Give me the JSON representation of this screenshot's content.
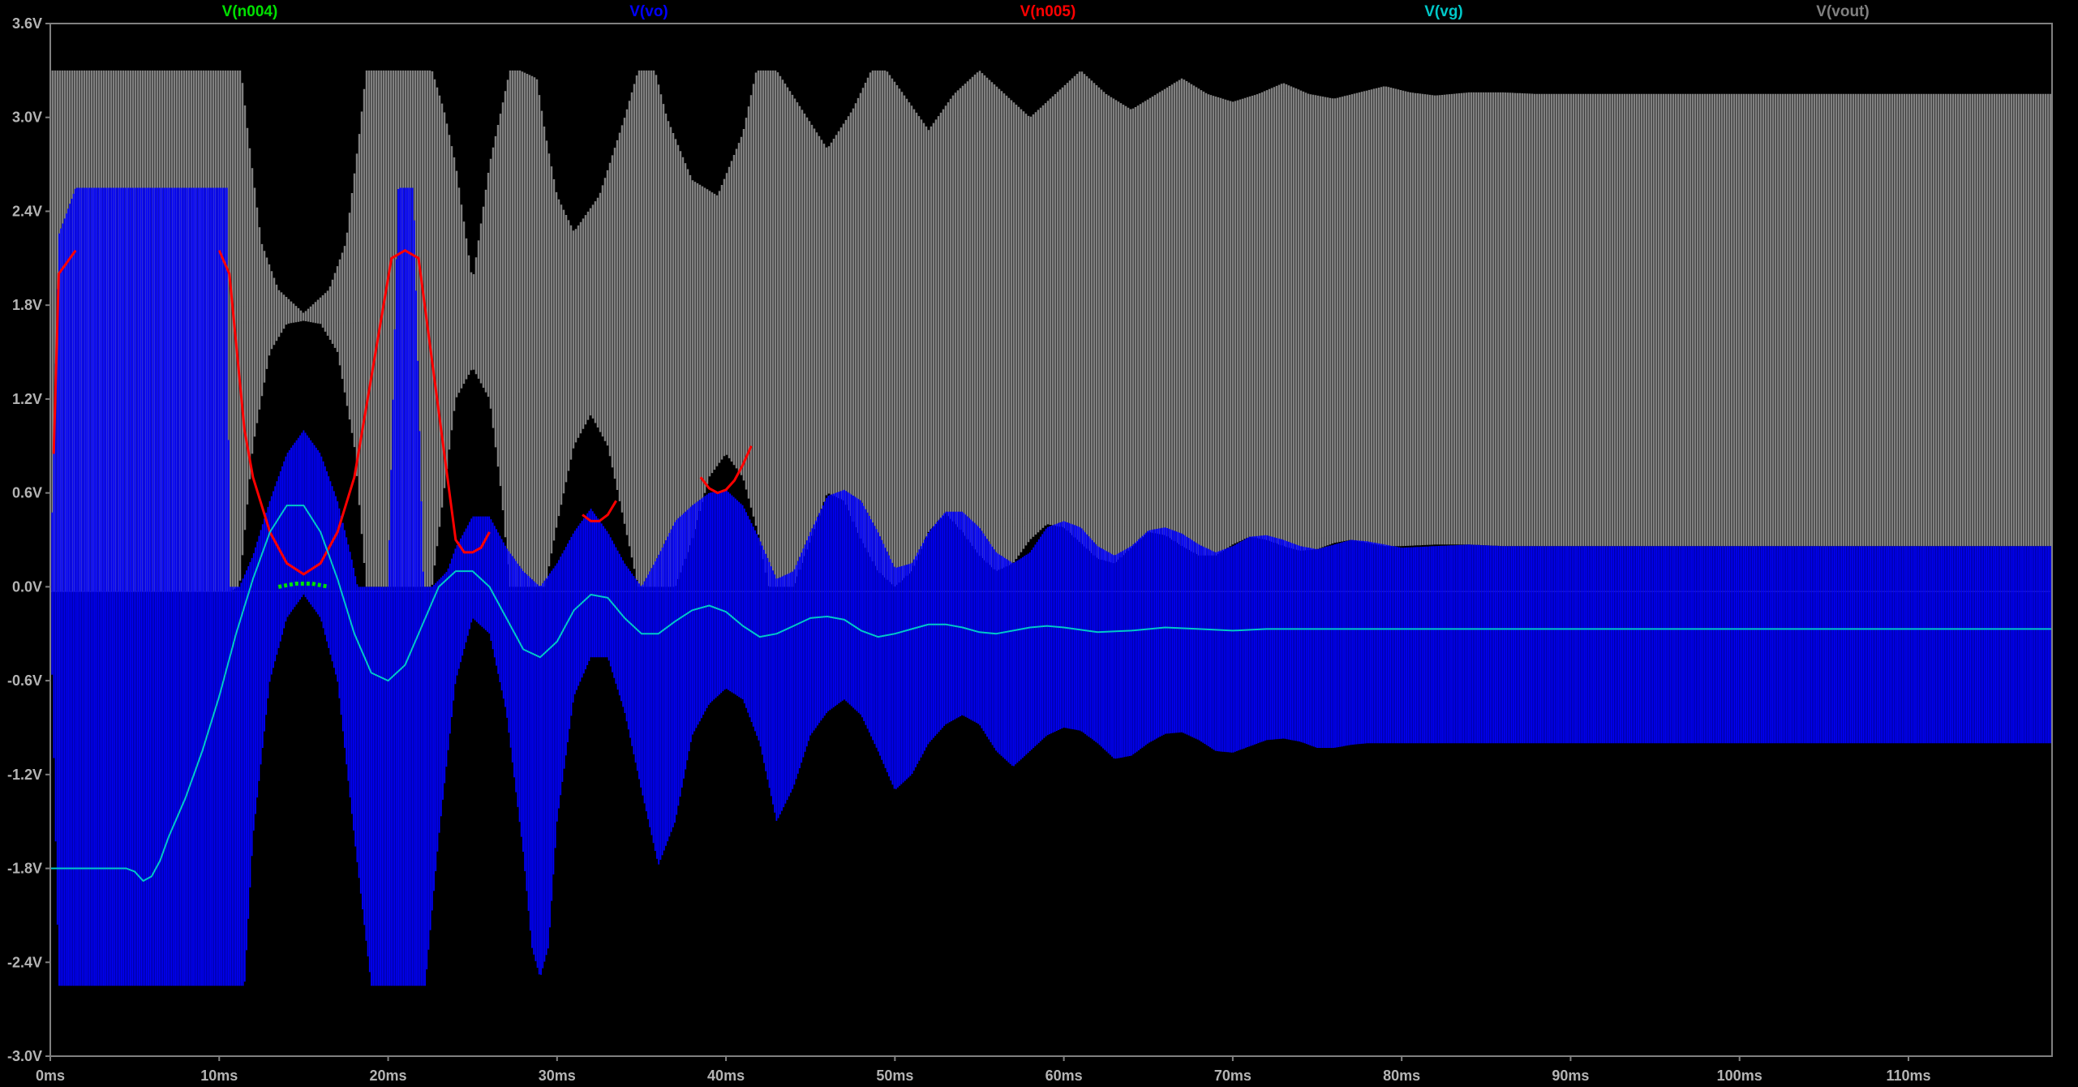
{
  "chart_data": {
    "type": "line",
    "title": "",
    "xlabel": "",
    "ylabel": "",
    "x_unit": "ms",
    "y_unit": "V",
    "xlim": [
      0,
      118.5
    ],
    "ylim": [
      -3.0,
      3.6
    ],
    "grid": false,
    "legend_placement": "top",
    "background": "#000000",
    "plot_border": "#808080",
    "x_ticks": [
      0,
      10,
      20,
      30,
      40,
      50,
      60,
      70,
      80,
      90,
      100,
      110
    ],
    "x_tick_labels": [
      "0ms",
      "10ms",
      "20ms",
      "30ms",
      "40ms",
      "50ms",
      "60ms",
      "70ms",
      "80ms",
      "90ms",
      "100ms",
      "110ms"
    ],
    "y_ticks": [
      3.6,
      3.0,
      2.4,
      1.8,
      1.2,
      0.6,
      0.0,
      -0.6,
      -1.2,
      -1.8,
      -2.4,
      -3.0
    ],
    "y_tick_labels": [
      "3.6V",
      "3.0V",
      "2.4V",
      "1.8V",
      "1.2V",
      "0.6V",
      "0.0V",
      "-0.6V",
      "-1.2V",
      "-1.8V",
      "-2.4V",
      "-3.0V"
    ],
    "series": [
      {
        "name": "V(n004)",
        "color": "#00e000",
        "description_note": "",
        "x": [
          13.5,
          14.0,
          14.5,
          15.0,
          15.5,
          16.0,
          16.5
        ],
        "y": [
          0.0,
          0.01,
          0.02,
          0.02,
          0.02,
          0.01,
          0.0
        ]
      },
      {
        "name": "V(vo)",
        "color": "#0000ff",
        "upper_envelope": {
          "x": [
            0,
            0.5,
            1.5,
            10.5,
            10.6,
            11.2,
            12,
            13,
            14,
            15,
            16,
            17,
            17.8,
            18.2,
            19.5,
            20,
            20.6,
            21.5,
            22.1,
            22.6,
            23.5,
            24,
            25,
            26,
            27,
            28,
            29,
            30,
            31,
            32,
            33,
            34,
            35,
            36,
            37,
            38,
            39,
            40,
            41,
            42,
            43,
            44,
            45,
            46,
            47,
            48,
            49,
            50,
            51,
            52,
            53,
            54,
            55,
            56,
            57,
            58,
            59,
            60,
            61,
            62,
            63,
            64,
            65,
            66,
            67,
            68,
            69,
            70,
            71,
            72,
            73,
            74,
            75,
            76,
            77,
            78,
            79,
            80,
            82,
            84,
            86,
            88,
            90,
            95,
            100,
            105,
            110,
            118.5
          ],
          "y": [
            0.0,
            2.25,
            2.55,
            2.55,
            0.0,
            0.0,
            0.2,
            0.55,
            0.85,
            1.0,
            0.85,
            0.55,
            0.2,
            0.0,
            0.0,
            0.0,
            2.55,
            2.55,
            0.0,
            0.0,
            0.1,
            0.25,
            0.45,
            0.45,
            0.25,
            0.1,
            0.0,
            0.15,
            0.35,
            0.5,
            0.35,
            0.15,
            0.0,
            0.2,
            0.42,
            0.52,
            0.6,
            0.62,
            0.52,
            0.3,
            0.05,
            0.1,
            0.35,
            0.58,
            0.62,
            0.55,
            0.35,
            0.12,
            0.15,
            0.35,
            0.48,
            0.48,
            0.38,
            0.22,
            0.15,
            0.22,
            0.38,
            0.42,
            0.38,
            0.26,
            0.2,
            0.26,
            0.36,
            0.38,
            0.34,
            0.27,
            0.22,
            0.26,
            0.32,
            0.33,
            0.3,
            0.26,
            0.24,
            0.27,
            0.3,
            0.29,
            0.27,
            0.25,
            0.26,
            0.27,
            0.26,
            0.26,
            0.26,
            0.26,
            0.26,
            0.26,
            0.26,
            0.26
          ]
        },
        "lower_envelope": {
          "x": [
            0,
            0.5,
            10.5,
            10.6,
            11.5,
            12,
            13,
            14,
            15,
            16,
            17,
            18,
            19,
            19.5,
            20,
            20.6,
            22.2,
            23,
            24,
            25,
            26,
            27,
            28,
            28.5,
            29,
            29.5,
            30,
            31,
            32,
            33,
            34,
            35,
            36,
            37,
            38,
            39,
            40,
            41,
            42,
            43,
            44,
            45,
            46,
            47,
            48,
            49,
            50,
            51,
            52,
            53,
            54,
            55,
            56,
            57,
            58,
            59,
            60,
            61,
            62,
            63,
            64,
            65,
            66,
            67,
            68,
            69,
            70,
            71,
            72,
            73,
            74,
            75,
            76,
            77,
            78,
            79,
            80,
            82,
            84,
            86,
            88,
            90,
            95,
            100,
            105,
            110,
            118.5
          ],
          "y": [
            -0.03,
            -2.55,
            -2.55,
            -2.55,
            -2.55,
            -1.6,
            -0.6,
            -0.2,
            -0.05,
            -0.2,
            -0.6,
            -1.6,
            -2.55,
            -2.55,
            -2.55,
            -2.55,
            -2.55,
            -1.6,
            -0.6,
            -0.2,
            -0.3,
            -0.8,
            -1.7,
            -2.3,
            -2.5,
            -2.3,
            -1.5,
            -0.7,
            -0.45,
            -0.45,
            -0.8,
            -1.3,
            -1.78,
            -1.5,
            -0.95,
            -0.75,
            -0.65,
            -0.72,
            -1.0,
            -1.5,
            -1.28,
            -0.95,
            -0.8,
            -0.72,
            -0.82,
            -1.05,
            -1.3,
            -1.2,
            -1.0,
            -0.88,
            -0.82,
            -0.88,
            -1.05,
            -1.15,
            -1.05,
            -0.95,
            -0.9,
            -0.92,
            -1.0,
            -1.1,
            -1.08,
            -1.0,
            -0.94,
            -0.93,
            -0.98,
            -1.05,
            -1.06,
            -1.02,
            -0.98,
            -0.97,
            -0.99,
            -1.03,
            -1.03,
            -1.01,
            -1.0,
            -1.0,
            -1.0,
            -1.0,
            -1.0,
            -1.0,
            -1.0,
            -1.0,
            -1.0,
            -1.0,
            -1.0,
            -1.0,
            -1.0
          ]
        }
      },
      {
        "name": "V(n005)",
        "color": "#ff0000",
        "x": [
          0.2,
          0.5,
          1.5,
          5,
          10,
          10.6,
          11.5,
          12,
          13,
          14,
          15,
          16,
          17,
          18,
          20.2,
          21,
          21.8,
          24,
          24.5,
          25,
          25.5,
          26,
          31.5,
          32,
          32.5,
          33,
          33.5,
          38.5,
          39,
          39.5,
          40,
          40.5,
          41,
          41.5
        ],
        "y": [
          0.85,
          2.0,
          2.15,
          2.15,
          2.15,
          2.0,
          1.0,
          0.7,
          0.35,
          0.15,
          0.08,
          0.15,
          0.35,
          0.7,
          2.1,
          2.15,
          2.1,
          0.3,
          0.22,
          0.22,
          0.25,
          0.35,
          0.46,
          0.42,
          0.42,
          0.46,
          0.55,
          0.7,
          0.63,
          0.6,
          0.62,
          0.68,
          0.78,
          0.9
        ]
      },
      {
        "name": "V(vg)",
        "color": "#00c8c8",
        "x": [
          0,
          1,
          2,
          3,
          4,
          4.5,
          5,
          5.5,
          6,
          6.5,
          7,
          8,
          9,
          10,
          11,
          12,
          13,
          14,
          15,
          16,
          17,
          18,
          19,
          20,
          21,
          22,
          23,
          24,
          25,
          26,
          27,
          28,
          29,
          30,
          31,
          32,
          33,
          34,
          35,
          36,
          37,
          38,
          39,
          40,
          41,
          42,
          43,
          44,
          45,
          46,
          47,
          48,
          49,
          50,
          51,
          52,
          53,
          54,
          55,
          56,
          57,
          58,
          59,
          60,
          62,
          64,
          66,
          68,
          70,
          72,
          74,
          76,
          78,
          80,
          85,
          90,
          95,
          100,
          105,
          110,
          118.5
        ],
        "y": [
          -1.8,
          -1.8,
          -1.8,
          -1.8,
          -1.8,
          -1.8,
          -1.82,
          -1.88,
          -1.85,
          -1.75,
          -1.6,
          -1.35,
          -1.05,
          -0.7,
          -0.3,
          0.05,
          0.35,
          0.52,
          0.52,
          0.35,
          0.05,
          -0.3,
          -0.55,
          -0.6,
          -0.5,
          -0.25,
          0.0,
          0.1,
          0.1,
          0.0,
          -0.2,
          -0.4,
          -0.45,
          -0.35,
          -0.15,
          -0.05,
          -0.07,
          -0.2,
          -0.3,
          -0.3,
          -0.22,
          -0.15,
          -0.12,
          -0.16,
          -0.25,
          -0.32,
          -0.3,
          -0.25,
          -0.2,
          -0.19,
          -0.21,
          -0.28,
          -0.32,
          -0.3,
          -0.27,
          -0.24,
          -0.24,
          -0.26,
          -0.29,
          -0.3,
          -0.28,
          -0.26,
          -0.25,
          -0.26,
          -0.29,
          -0.28,
          -0.26,
          -0.27,
          -0.28,
          -0.27,
          -0.27,
          -0.27,
          -0.27,
          -0.27,
          -0.27,
          -0.27,
          -0.27,
          -0.27,
          -0.27,
          -0.27,
          -0.27
        ]
      },
      {
        "name": "V(vout)",
        "color": "#808080",
        "upper_envelope": {
          "x": [
            0,
            10.6,
            11.3,
            11.7,
            12.5,
            13.5,
            15,
            16.5,
            17.5,
            18.3,
            18.7,
            22.6,
            23.3,
            24,
            25,
            26,
            26.7,
            27.2,
            27.8,
            28.8,
            29.3,
            30,
            31,
            32.5,
            34,
            34.8,
            35.3,
            35.8,
            36.5,
            38,
            39.5,
            41,
            41.8,
            42.5,
            43,
            44.5,
            46,
            47.5,
            48.6,
            49.5,
            50.5,
            52,
            53.5,
            55,
            56.5,
            58,
            59.5,
            61,
            62.5,
            64,
            65.5,
            67,
            68.5,
            70,
            71.5,
            73,
            74.5,
            76,
            77.5,
            79,
            80.5,
            82,
            84,
            86,
            88,
            90,
            95,
            100,
            105,
            110,
            118.5
          ],
          "y": [
            3.3,
            3.3,
            3.3,
            2.9,
            2.2,
            1.9,
            1.75,
            1.9,
            2.2,
            2.9,
            3.3,
            3.3,
            3.05,
            2.7,
            1.95,
            2.7,
            3.05,
            3.3,
            3.3,
            3.25,
            2.9,
            2.5,
            2.27,
            2.5,
            3.0,
            3.3,
            3.3,
            3.3,
            3.0,
            2.6,
            2.5,
            2.9,
            3.3,
            3.3,
            3.3,
            3.05,
            2.8,
            3.05,
            3.3,
            3.3,
            3.15,
            2.92,
            3.15,
            3.3,
            3.15,
            3.0,
            3.15,
            3.3,
            3.15,
            3.05,
            3.15,
            3.25,
            3.15,
            3.1,
            3.15,
            3.22,
            3.15,
            3.12,
            3.16,
            3.2,
            3.16,
            3.14,
            3.16,
            3.16,
            3.15,
            3.15,
            3.15,
            3.15,
            3.15,
            3.15,
            3.15
          ]
        },
        "lower_envelope": {
          "x": [
            0,
            10.6,
            11.2,
            12,
            13,
            14,
            15,
            16,
            17,
            18,
            18.7,
            22.6,
            23.3,
            24,
            25,
            26,
            26.7,
            27.2,
            29.3,
            30,
            31,
            32,
            33,
            34,
            34.8,
            35.3,
            36,
            37,
            38,
            39,
            40,
            41,
            42,
            42.5,
            43,
            44,
            45,
            46,
            47,
            48,
            49,
            50,
            51,
            52,
            53,
            54,
            55,
            56,
            57,
            58,
            59,
            60,
            61,
            62,
            63,
            64,
            65,
            66,
            67,
            68,
            69,
            70,
            71,
            72,
            73,
            74,
            75,
            76,
            77,
            78,
            79,
            80,
            82,
            84,
            86,
            88,
            90,
            95,
            100,
            105,
            110,
            118.5
          ],
          "y": [
            -0.03,
            -0.03,
            0.0,
            0.9,
            1.5,
            1.68,
            1.7,
            1.68,
            1.5,
            0.9,
            0.0,
            0.0,
            0.6,
            1.2,
            1.4,
            1.2,
            0.6,
            0.0,
            0.0,
            0.4,
            0.9,
            1.1,
            0.9,
            0.4,
            0.0,
            0.0,
            0.0,
            0.0,
            0.3,
            0.7,
            0.85,
            0.7,
            0.3,
            0.0,
            0.0,
            0.0,
            0.3,
            0.6,
            0.55,
            0.3,
            0.1,
            0.0,
            0.1,
            0.35,
            0.47,
            0.35,
            0.2,
            0.1,
            0.15,
            0.3,
            0.4,
            0.38,
            0.28,
            0.18,
            0.15,
            0.25,
            0.35,
            0.33,
            0.26,
            0.2,
            0.2,
            0.27,
            0.32,
            0.3,
            0.26,
            0.23,
            0.24,
            0.28,
            0.3,
            0.28,
            0.26,
            0.26,
            0.27,
            0.27,
            0.26,
            0.26,
            0.26,
            0.26,
            0.26,
            0.26,
            0.26,
            0.26
          ]
        }
      }
    ]
  }
}
